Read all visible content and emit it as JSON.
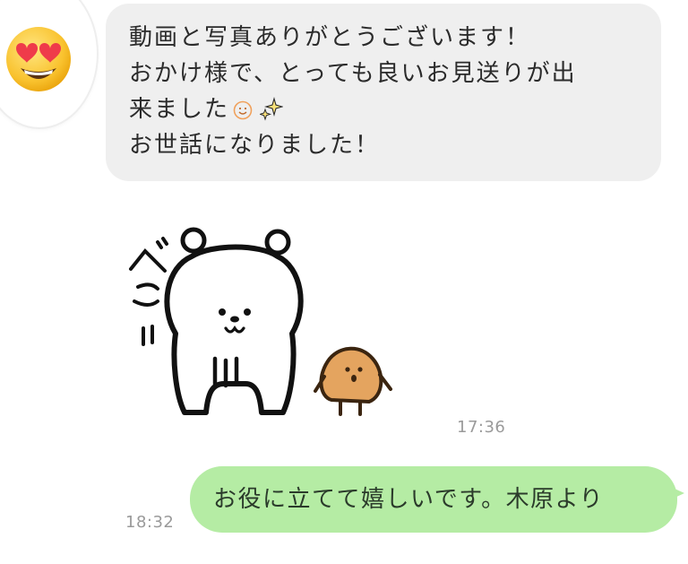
{
  "incoming": {
    "lines": [
      "動画と写真ありがとうございます！",
      "おかけ様で、とっても良いお見送りが出",
      "来ました",
      "お世話になりました！"
    ],
    "emoji_icons": [
      "smiling-face-icon",
      "sparkles-icon"
    ]
  },
  "sticker": {
    "onomatopoeia": "ペこ"
  },
  "times": {
    "incoming": "17:36",
    "outgoing": "18:32"
  },
  "outgoing": {
    "text": "お役に立てて嬉しいです。木原より"
  },
  "colors": {
    "incoming_bubble": "#efefef",
    "outgoing_bubble": "#b5eca4",
    "timestamp": "#9a9a9a"
  },
  "avatar": {
    "icon": "heart-eyes-emoji-icon"
  }
}
